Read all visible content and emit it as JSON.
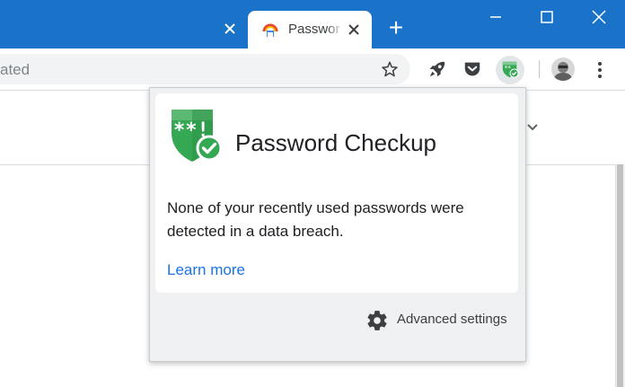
{
  "tabs": {
    "active_title": "Passwor",
    "new_tab_symbol": "+"
  },
  "omnibox": {
    "text": "ated"
  },
  "popup": {
    "title": "Password Checkup",
    "message": "None of your recently used passwords were detected in a data breach.",
    "learn_more": "Learn more",
    "advanced_settings": "Advanced settings"
  },
  "icons": {
    "tab_close": "close-icon",
    "new_tab": "plus-icon",
    "window": [
      "minimize-icon",
      "maximize-icon",
      "close-icon"
    ],
    "toolbar": [
      "star-icon",
      "rocket-icon",
      "pocket-icon",
      "password-checkup-icon",
      "avatar",
      "menu-icon"
    ],
    "popup": [
      "shield-check-icon",
      "gear-icon"
    ]
  },
  "colors": {
    "titlebar": "#1a73c9",
    "shield_green": "#34a853",
    "link_blue": "#1a73e8"
  }
}
